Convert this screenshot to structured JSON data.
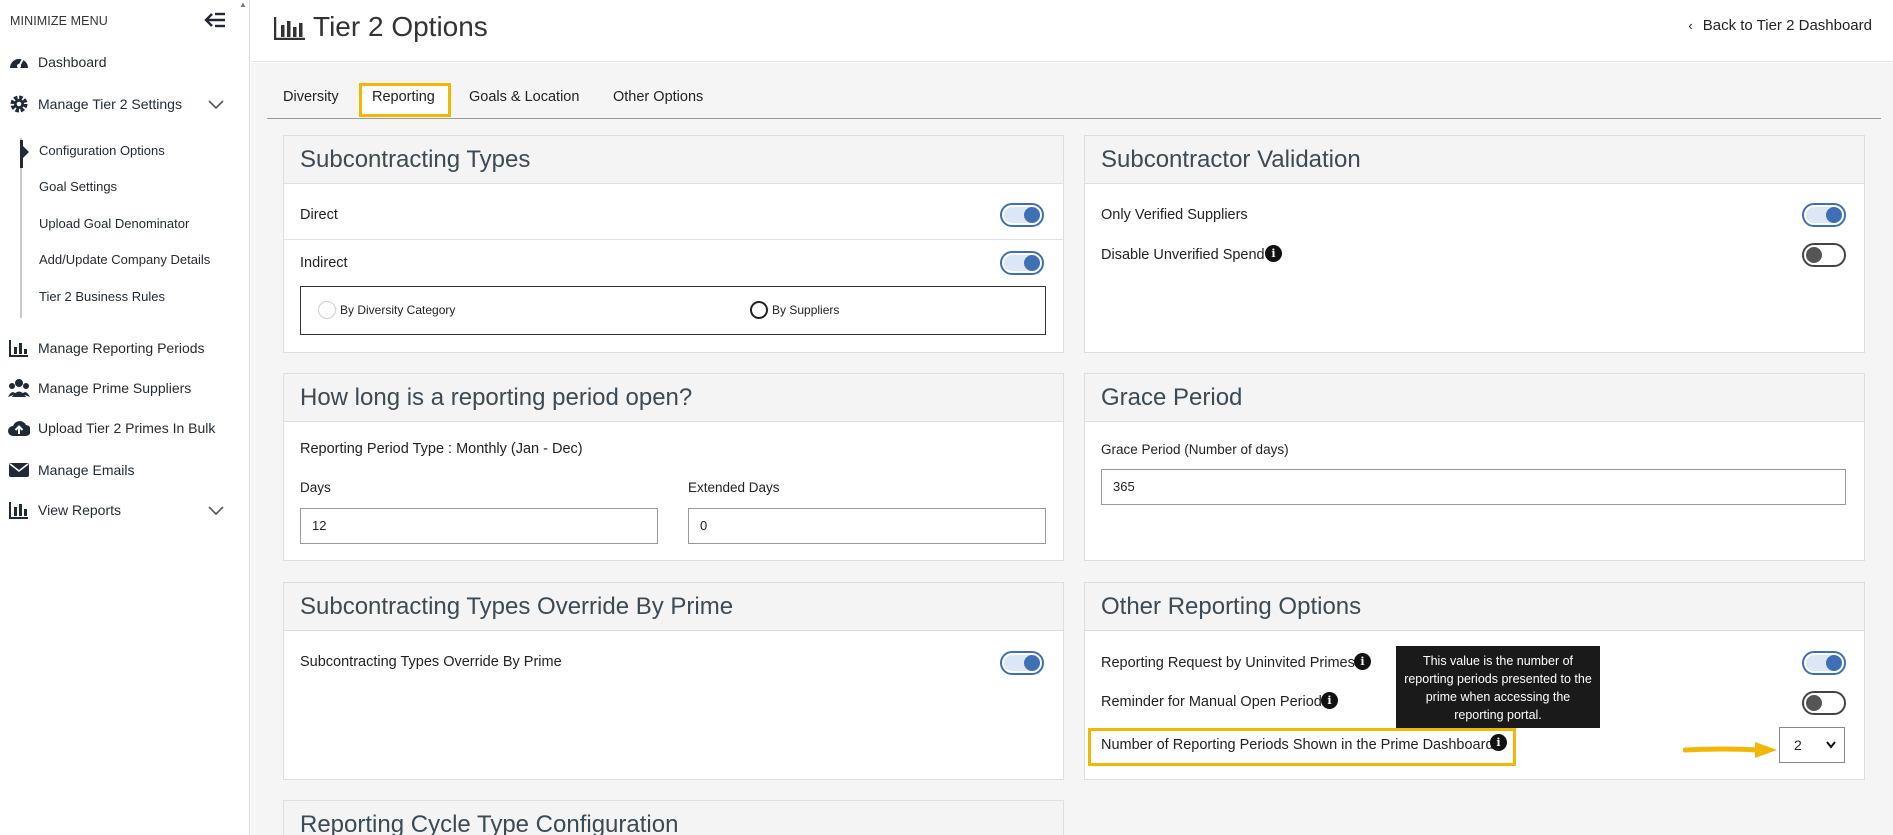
{
  "sidebar": {
    "minimize_label": "MINIMIZE MENU",
    "items": [
      {
        "label": "Dashboard",
        "icon": "dashboard-gauge-icon"
      },
      {
        "label": "Manage Tier 2 Settings",
        "icon": "gear-icon"
      },
      {
        "label": "Manage Reporting Periods",
        "icon": "bar-chart-icon"
      },
      {
        "label": "Manage Prime Suppliers",
        "icon": "people-group-icon"
      },
      {
        "label": "Upload Tier 2 Primes In Bulk",
        "icon": "cloud-upload-icon"
      },
      {
        "label": "Manage Emails",
        "icon": "envelope-icon"
      },
      {
        "label": "View Reports",
        "icon": "report-chart-icon"
      }
    ],
    "sub_items": [
      {
        "label": "Configuration Options",
        "active": true
      },
      {
        "label": "Goal Settings"
      },
      {
        "label": "Upload Goal Denominator"
      },
      {
        "label": "Add/Update Company Details"
      },
      {
        "label": "Tier 2 Business Rules"
      }
    ]
  },
  "header": {
    "title": "Tier 2 Options",
    "back_link": "Back to Tier 2 Dashboard"
  },
  "tabs": [
    {
      "label": "Diversity"
    },
    {
      "label": "Reporting",
      "active": true
    },
    {
      "label": "Goals & Location"
    },
    {
      "label": "Other Options"
    }
  ],
  "subcontracting_types": {
    "title": "Subcontracting Types",
    "direct_label": "Direct",
    "direct_on": true,
    "indirect_label": "Indirect",
    "indirect_on": true,
    "radio_diversity": "By Diversity Category",
    "radio_suppliers": "By Suppliers"
  },
  "subcontractor_validation": {
    "title": "Subcontractor Validation",
    "verified_label": "Only Verified Suppliers",
    "verified_on": true,
    "unverified_label": "Disable Unverified Spend",
    "unverified_on": false
  },
  "reporting_period": {
    "title": "How long is a reporting period open?",
    "type_text": "Reporting Period Type : Monthly (Jan - Dec)",
    "days_label": "Days",
    "days_value": "12",
    "extended_label": "Extended Days",
    "extended_value": "0"
  },
  "grace_period": {
    "title": "Grace Period",
    "label": "Grace Period (Number of days)",
    "value": "365"
  },
  "override": {
    "title": "Subcontracting Types Override By Prime",
    "label": "Subcontracting Types Override By Prime",
    "on": true
  },
  "other_reporting": {
    "title": "Other Reporting Options",
    "uninvited_label": "Reporting Request by Uninvited Primes",
    "uninvited_on": true,
    "reminder_label": "Reminder for Manual Open Period",
    "reminder_on": false,
    "periods_label": "Number of Reporting Periods Shown in the Prime Dashboard",
    "periods_value": "2",
    "tooltip": "This value is the number of reporting periods presented to the prime when accessing the reporting portal."
  },
  "reporting_cycle": {
    "title": "Reporting Cycle Type Configuration"
  },
  "colors": {
    "accent_blue": "#3f6fb5",
    "highlight": "#f2b705",
    "nav_text": "#1f2a36"
  }
}
